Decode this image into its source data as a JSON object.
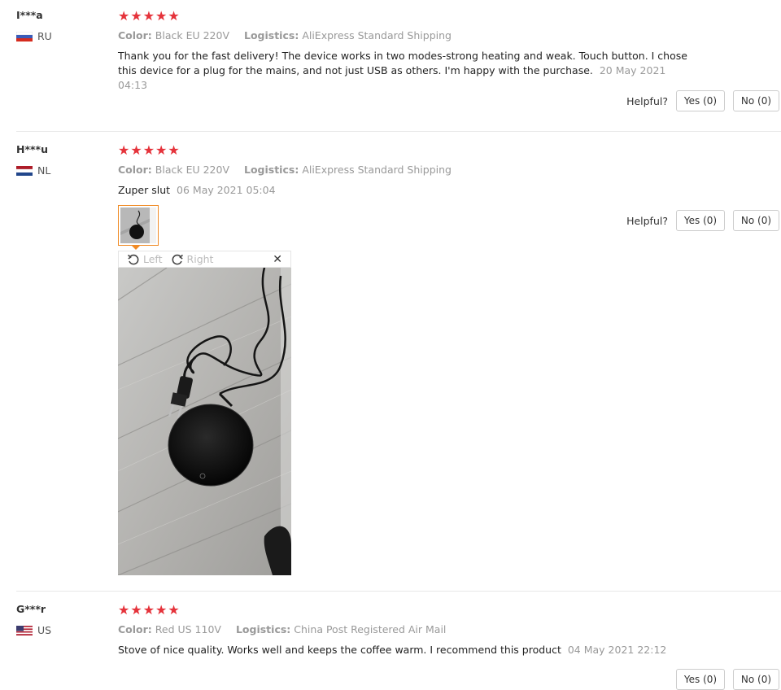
{
  "attr_labels": {
    "color": "Color:",
    "logistics": "Logistics:"
  },
  "helpful_label": "Helpful?",
  "stars": "★★★★★",
  "viewer": {
    "left": "Left",
    "right": "Right",
    "close": "✕"
  },
  "colors": {
    "star": "#e5333b",
    "thumb_border": "#f08a24",
    "muted": "#999999"
  },
  "reviews": [
    {
      "user": "I***a",
      "country": "RU",
      "color": "Black EU 220V",
      "logistics": "AliExpress Standard Shipping",
      "text": "Thank you for the fast delivery! The device works in two modes-strong heating and weak. Touch button. I chose this device for a plug for the mains, and not just USB as others. I'm happy with the purchase.",
      "date": "20 May 2021 04:13",
      "yes": "Yes (0)",
      "no": "No (0)"
    },
    {
      "user": "H***u",
      "country": "NL",
      "color": "Black EU 220V",
      "logistics": "AliExpress Standard Shipping",
      "text": "Zuper slut",
      "date": "06 May 2021 05:04",
      "yes": "Yes (0)",
      "no": "No (0)"
    },
    {
      "user": "G***r",
      "country": "US",
      "color": "Red US 110V",
      "logistics": "China Post Registered Air Mail",
      "text": "Stove of nice quality. Works well and keeps the coffee warm. I recommend this product",
      "date": "04 May 2021 22:12",
      "yes": "Yes (0)",
      "no": "No (0)"
    }
  ]
}
